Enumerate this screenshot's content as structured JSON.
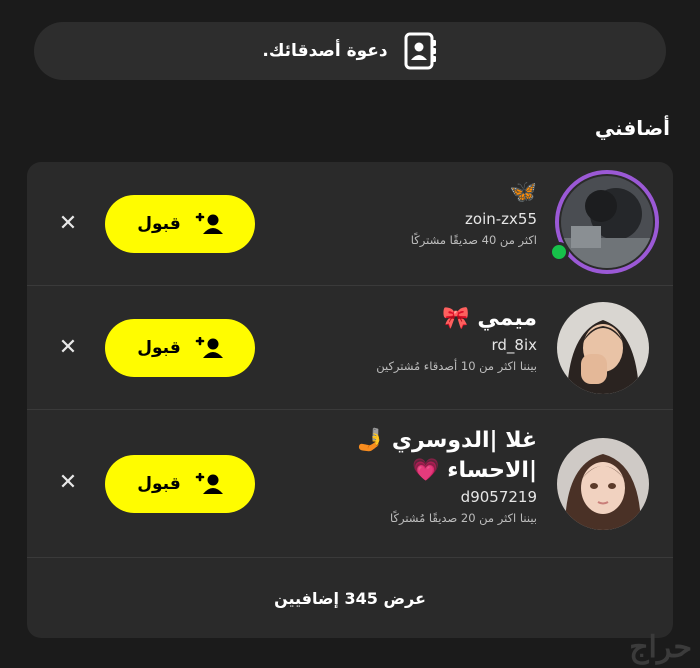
{
  "invite": {
    "label": "دعوة أصدقائك.",
    "icon": "contacts-book-icon"
  },
  "section": {
    "title": "أضافني"
  },
  "requests": [
    {
      "name_emoji": "🦋",
      "username": "zoin-zx55",
      "mutual": "اكثر من 40 صديقًا مشتركًا",
      "accept_label": "قبول",
      "online": true,
      "ring_color": "#9b59d6"
    },
    {
      "name": "ميمي",
      "name_emoji": "🎀",
      "username": "rd_8ix",
      "mutual": "بيننا اكثر من 10 أصدقاء مُشتركين",
      "accept_label": "قبول"
    },
    {
      "name_line1": "غلا |الدوسري",
      "name_line1_emoji": "🤳",
      "name_line2": "|الاحساء",
      "name_line2_emoji": "💗",
      "username": "d9057219",
      "mutual": "بيننا اكثر من 20 صديقًا مُشتركًا",
      "accept_label": "قبول"
    }
  ],
  "footer": {
    "label": "عرض 345 إضافيين"
  },
  "watermark": "حراج",
  "colors": {
    "accent": "#fffc00",
    "background": "#1b1b1b",
    "card": "#2a2a2a",
    "online": "#17c24a"
  }
}
